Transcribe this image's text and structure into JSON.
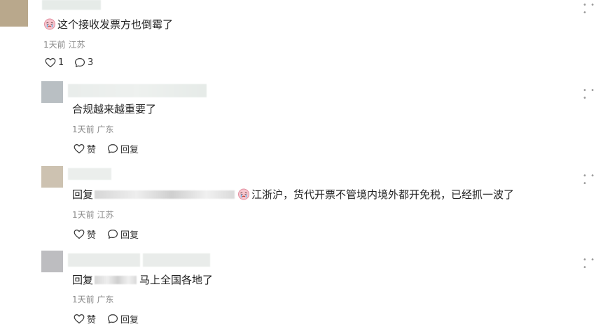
{
  "comments": [
    {
      "text": "这个接收发票方也倒霉了",
      "time": "1天前",
      "location": "江苏",
      "like_count": "1",
      "reply_count": "3"
    }
  ],
  "replies": [
    {
      "text": "合规越来越重要了",
      "time": "1天前",
      "location": "广东",
      "like_label": "赞",
      "reply_label": "回复"
    },
    {
      "reply_prefix": "回复",
      "text": "江浙沪，货代开票不管境内境外都开免税，已经抓一波了",
      "time": "1天前",
      "location": "江苏",
      "like_label": "赞",
      "reply_label": "回复"
    },
    {
      "reply_prefix": "回复",
      "text": "马上全国各地了",
      "time": "1天前",
      "location": "广东",
      "like_label": "赞",
      "reply_label": "回复"
    }
  ],
  "icons": {
    "like": "heart-outline-icon",
    "comment": "speech-bubble-outline-icon",
    "more": "ellipsis-icon",
    "emoji": "crying-face-emoji-icon"
  },
  "colors": {
    "text": "#222222",
    "meta": "#8a8a8a",
    "background": "#ffffff"
  }
}
